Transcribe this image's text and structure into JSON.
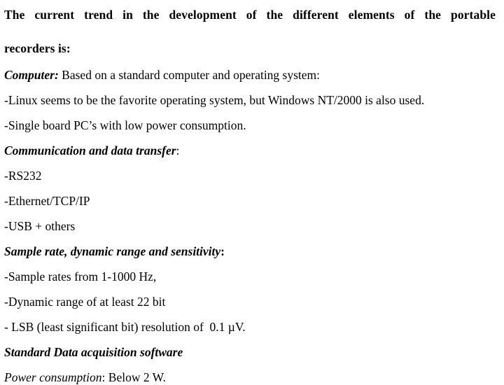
{
  "document": {
    "background_color": "#ffffff",
    "text_color": "#000000",
    "heading": {
      "line1": "The current trend in the development of the different elements of the portable",
      "line2": "recorders is:"
    },
    "sections": [
      {
        "id": "computer",
        "label": "Computer:",
        "label_style": "bold-italic",
        "trailing_text": " Based on a standard computer and operating system:",
        "bullets": [
          "-Linux seems to be the favorite operating system, but Windows NT/2000 is also used.",
          "-Single board PC’s with low power consumption."
        ]
      },
      {
        "id": "communication",
        "label": "Communication and data transfer",
        "label_style": "bold-italic",
        "label_suffix": ":",
        "label_suffix_style": "plain",
        "bullets": [
          "-RS232",
          "-Ethernet/TCP/IP",
          "-USB + others"
        ]
      },
      {
        "id": "sample-rate",
        "label": "Sample rate, dynamic range and sensitivity",
        "label_style": "bold-italic",
        "label_suffix": ":",
        "label_suffix_style": "bold-upright",
        "bullets": [
          "-Sample rates from 1-1000 Hz,",
          "-Dynamic range of at least 22 bit",
          "- LSB (least significant bit) resolution of  0.1 µV."
        ]
      },
      {
        "id": "software",
        "label": "Standard Data acquisition software",
        "label_style": "bold-italic",
        "label_suffix": "",
        "bullets": []
      },
      {
        "id": "power",
        "label": "Power consumption",
        "label_style": "italic",
        "label_suffix": ":",
        "label_suffix_style": "plain",
        "trailing_text": " Below 2 W.",
        "bullets": []
      }
    ]
  }
}
